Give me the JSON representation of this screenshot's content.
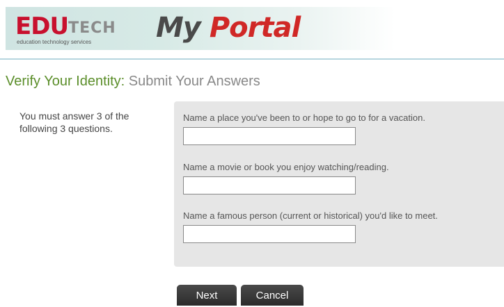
{
  "header": {
    "logo_main": "EDU",
    "logo_tech": "TECH",
    "logo_tagline": "education technology services",
    "portal_my": "My",
    "portal_word": "Portal"
  },
  "page": {
    "heading_primary": "Verify Your Identity:",
    "heading_secondary": "Submit Your Answers",
    "instructions": "You must answer 3 of the following 3 questions."
  },
  "questions": [
    {
      "label": "Name a place you've been to or hope to go to for a vacation.",
      "value": ""
    },
    {
      "label": "Name a movie or book you enjoy watching/reading.",
      "value": ""
    },
    {
      "label": "Name a famous person (current or historical) you'd like to meet.",
      "value": ""
    }
  ],
  "buttons": {
    "next_label": "Next",
    "cancel_label": "Cancel"
  },
  "colors": {
    "brand_red": "#c8102e",
    "heading_green": "#5b8e2a",
    "panel_gray": "#e6e6e6",
    "button_dark": "#2b2b2b"
  }
}
